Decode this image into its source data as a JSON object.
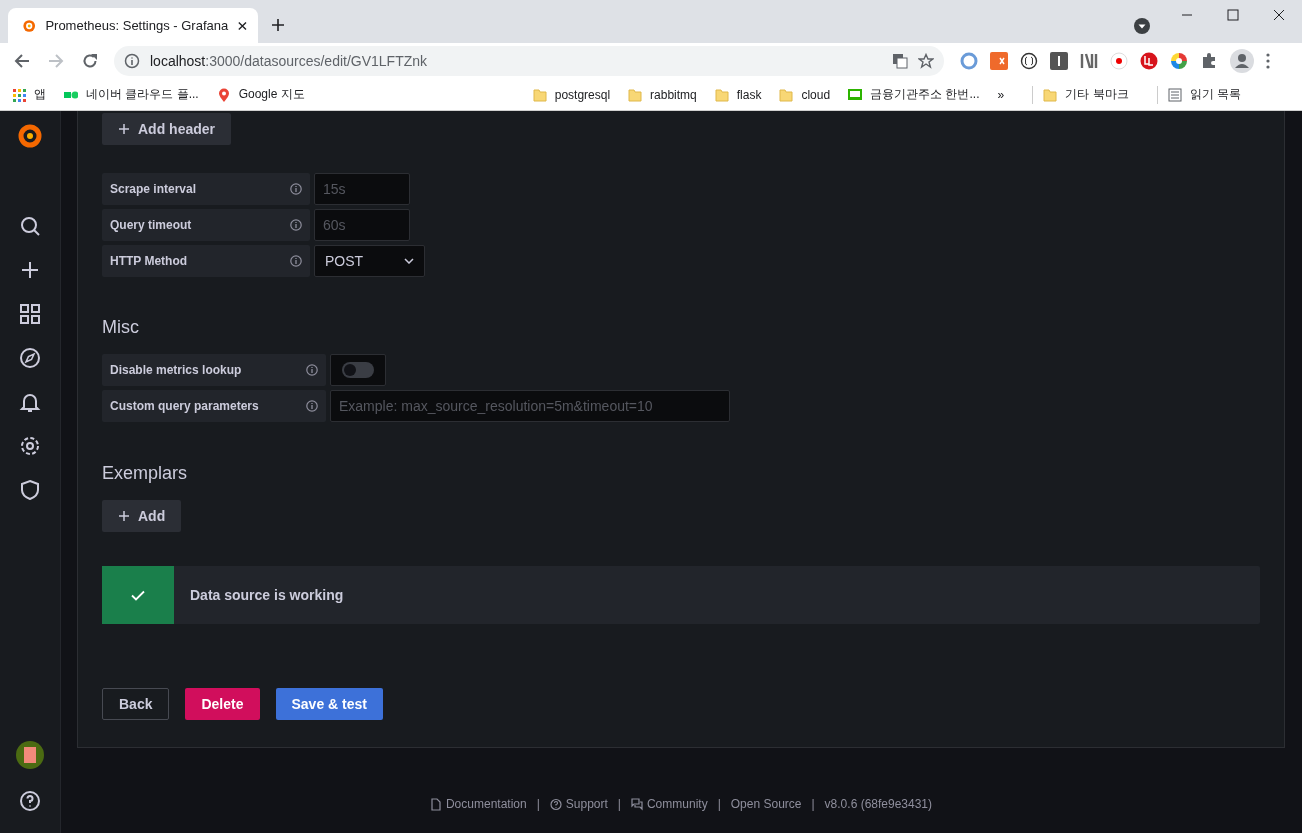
{
  "browser": {
    "tab_title": "Prometheus: Settings - Grafana",
    "url_host": "localhost",
    "url_path": ":3000/datasources/edit/GV1LFTZnk",
    "bookmarks": [
      {
        "kind": "apps",
        "label": "앱"
      },
      {
        "kind": "naver",
        "label": "네이버 클라우드 플..."
      },
      {
        "kind": "maps",
        "label": "Google 지도"
      },
      {
        "kind": "folder",
        "label": "postgresql"
      },
      {
        "kind": "folder",
        "label": "rabbitmq"
      },
      {
        "kind": "folder",
        "label": "flask"
      },
      {
        "kind": "folder",
        "label": "cloud"
      },
      {
        "kind": "blog",
        "label": "금융기관주소 한번..."
      }
    ],
    "overflow": "»",
    "other_bookmarks": "기타 북마크",
    "reading_list": "읽기 목록"
  },
  "add_header_button": "Add header",
  "http_settings": [
    {
      "kind": "input",
      "label": "Scrape interval",
      "placeholder": "15s"
    },
    {
      "kind": "input",
      "label": "Query timeout",
      "placeholder": "60s"
    },
    {
      "kind": "select",
      "label": "HTTP Method",
      "value": "POST"
    }
  ],
  "misc": {
    "title": "Misc",
    "rows": [
      {
        "kind": "toggle",
        "label": "Disable metrics lookup",
        "on": false
      },
      {
        "kind": "wide_input",
        "label": "Custom query parameters",
        "placeholder": "Example: max_source_resolution=5m&timeout=10"
      }
    ]
  },
  "exemplars": {
    "title": "Exemplars",
    "add_button": "Add"
  },
  "alert": {
    "message": "Data source is working"
  },
  "buttons": [
    {
      "kind": "secondary",
      "label": "Back"
    },
    {
      "kind": "destructive",
      "label": "Delete"
    },
    {
      "kind": "primary",
      "label": "Save & test"
    }
  ],
  "footer": [
    {
      "kind": "doc",
      "label": "Documentation"
    },
    {
      "kind": "separator",
      "label": "|"
    },
    {
      "kind": "help",
      "label": "Support"
    },
    {
      "kind": "separator",
      "label": "|"
    },
    {
      "kind": "chat",
      "label": "Community"
    },
    {
      "kind": "separator",
      "label": "|"
    },
    {
      "kind": "plain",
      "label": "Open Source"
    },
    {
      "kind": "separator",
      "label": "|"
    },
    {
      "kind": "version",
      "label": "v8.0.6 (68fe9e3431)"
    }
  ]
}
